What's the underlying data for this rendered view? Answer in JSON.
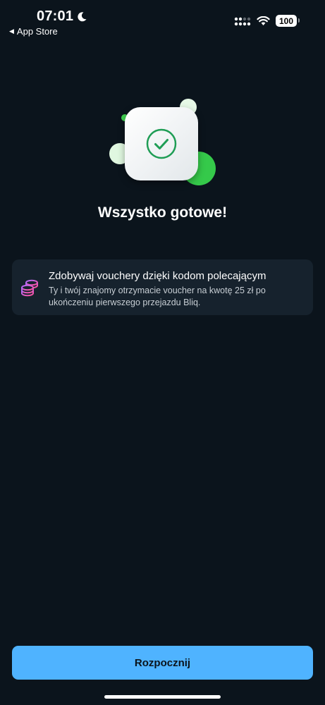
{
  "status_bar": {
    "time": "07:01",
    "back_label": "App Store",
    "battery": "100"
  },
  "icons": {
    "moon": "moon-icon",
    "signal": "cellular-signal-icon",
    "wifi": "wifi-icon",
    "battery": "battery-icon",
    "check": "checkmark-icon",
    "coins": "coins-icon"
  },
  "main": {
    "title": "Wszystko gotowe!"
  },
  "referral": {
    "title": "Zdobywaj vouchery dzięki kodom polecającym",
    "description": "Ty i twój znajomy otrzymacie voucher na kwotę 25 zł po ukończeniu pierwszego przejazdu Bliq."
  },
  "actions": {
    "start_label": "Rozpocznij"
  },
  "colors": {
    "background": "#0b141c",
    "card": "#16222d",
    "accent": "#4fb3ff",
    "success": "#35c94a"
  }
}
